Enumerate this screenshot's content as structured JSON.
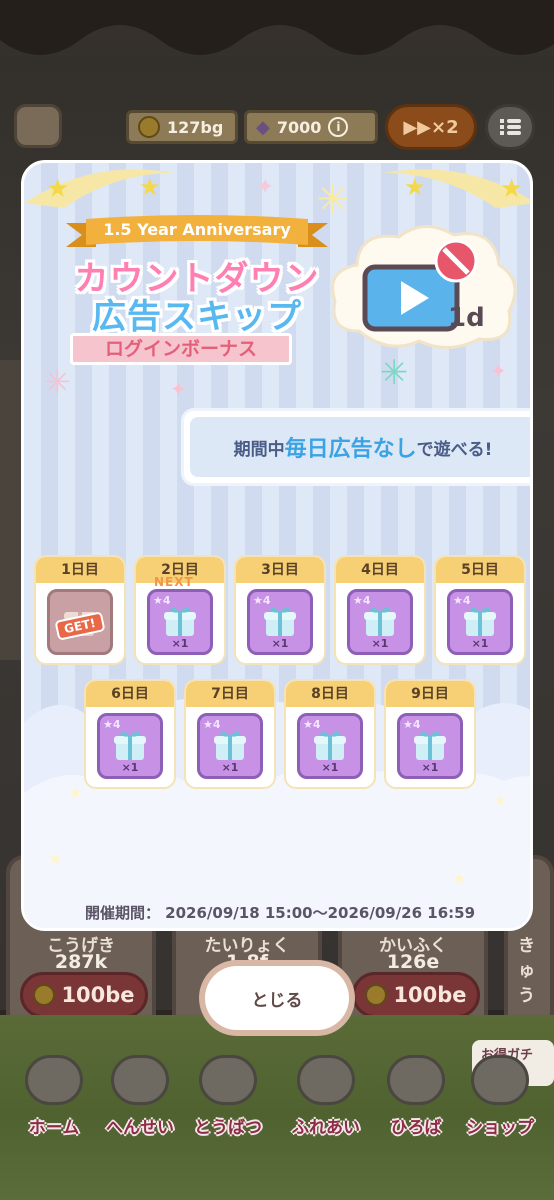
{
  "hud": {
    "coins": "127bg",
    "gems": "7000",
    "speed": "▶▶×2"
  },
  "background_cards": [
    {
      "label": "こうげき",
      "value": "287k",
      "cost": "100be"
    },
    {
      "label": "たいりょく",
      "value": "1.8f",
      "cost": ""
    },
    {
      "label": "かいふく",
      "value": "126e",
      "cost": "100be"
    },
    {
      "label": "きゅう",
      "value": "",
      "cost": ""
    }
  ],
  "nav": {
    "home": "ホーム",
    "henshin": "へんせい",
    "tobatsu": "とうばつ",
    "fureai": "ふれあい",
    "hiroba": "ひろば",
    "shop": "ショップ",
    "gacha_tag": "お得ガチャ"
  },
  "modal": {
    "anniversary": "1.5 Year Anniversary",
    "title_line1": "カウントダウン",
    "title_line2": "広告スキップ",
    "subtitle": "ログインボーナス",
    "ad_days": "1d",
    "promo": {
      "prefix": "期間中",
      "highlight": "毎日広告なし",
      "suffix": "で遊べる!"
    },
    "days": [
      {
        "label": "1日目",
        "status": "claimed",
        "badge": "GET!"
      },
      {
        "label": "2日目",
        "status": "next",
        "badge": "NEXT",
        "stars": "4",
        "count": "×1"
      },
      {
        "label": "3日目",
        "stars": "4",
        "count": "×1"
      },
      {
        "label": "4日目",
        "stars": "4",
        "count": "×1"
      },
      {
        "label": "5日目",
        "stars": "4",
        "count": "×1"
      },
      {
        "label": "6日目",
        "stars": "4",
        "count": "×1"
      },
      {
        "label": "7日目",
        "stars": "4",
        "count": "×1"
      },
      {
        "label": "8日目",
        "stars": "4",
        "count": "×1"
      },
      {
        "label": "9日目",
        "stars": "4",
        "count": "×1"
      }
    ],
    "period": "開催期間： 2026/09/18 15:00〜2026/09/26 16:59",
    "close_label": "とじる"
  },
  "colors": {
    "title_pink": "#ff7fb3",
    "title_blue": "#58b8f0",
    "ribbon": "#f2b13c",
    "gift_purple": "#c792e6"
  }
}
